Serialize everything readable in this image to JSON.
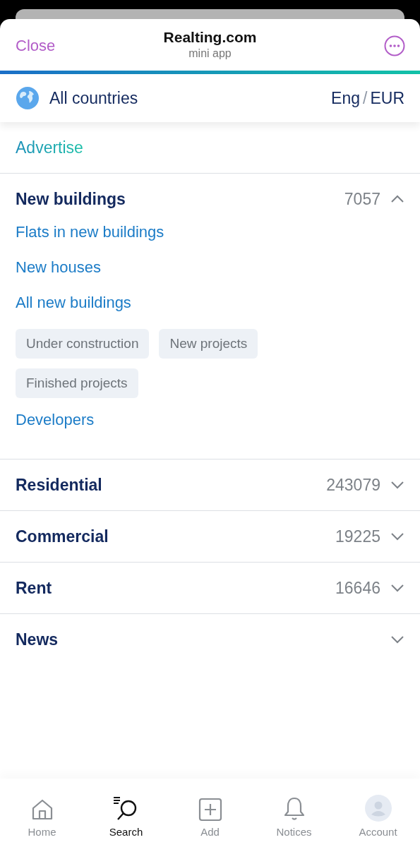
{
  "header": {
    "close": "Close",
    "title": "Realting.com",
    "subtitle": "mini app"
  },
  "region": {
    "country": "All countries",
    "language": "Eng",
    "separator": "/",
    "currency": "EUR"
  },
  "advertise": "Advertise",
  "sections": [
    {
      "title": "New buildings",
      "count": "7057",
      "expanded": true,
      "items": [
        {
          "kind": "link",
          "label": "Flats in new buildings"
        },
        {
          "kind": "link",
          "label": "New houses"
        },
        {
          "kind": "link",
          "label": "All new buildings"
        },
        {
          "kind": "tags",
          "labels": [
            "Under construction",
            "New projects",
            "Finished projects"
          ]
        },
        {
          "kind": "link",
          "label": "Developers"
        }
      ]
    },
    {
      "title": "Residential",
      "count": "243079",
      "expanded": false
    },
    {
      "title": "Commercial",
      "count": "19225",
      "expanded": false
    },
    {
      "title": "Rent",
      "count": "16646",
      "expanded": false
    },
    {
      "title": "News",
      "expanded": false
    }
  ],
  "tabs": [
    {
      "label": "Home",
      "selected": false
    },
    {
      "label": "Search",
      "selected": true
    },
    {
      "label": "Add",
      "selected": false
    },
    {
      "label": "Notices",
      "selected": false
    },
    {
      "label": "Account",
      "selected": false
    }
  ]
}
